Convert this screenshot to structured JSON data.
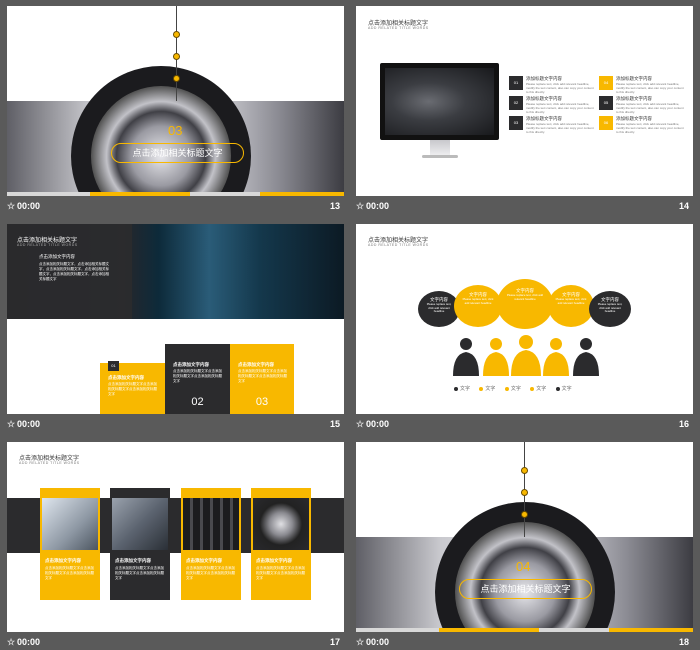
{
  "footer": {
    "time": "00:00",
    "star_icon": "star-icon"
  },
  "slides": [
    {
      "num": "13",
      "section_num": "03",
      "title": "点击添加相关标题文字"
    },
    {
      "num": "14",
      "title": "点击添加相关标题文字",
      "subtitle": "ADD RELATED TITLE WORDS",
      "items_left": [
        {
          "badge": "01",
          "heading": "添加标题文字内容"
        },
        {
          "badge": "02",
          "heading": "添加标题文字内容"
        },
        {
          "badge": "03",
          "heading": "添加标题文字内容"
        }
      ],
      "items_right": [
        {
          "badge": "04",
          "heading": "添加标题文字内容"
        },
        {
          "badge": "05",
          "heading": "添加标题文字内容"
        },
        {
          "badge": "06",
          "heading": "添加标题文字内容"
        }
      ],
      "body": "Please replace text, click add relevant headline, modify the text content, also can copy your content to this directly."
    },
    {
      "num": "15",
      "title": "点击添加相关标题文字",
      "subtitle": "ADD RELATED TITLE WORDS",
      "left_heading": "点击添加文字内容",
      "left_body": "点击添加相关标题文字，点击添加相关标题文字，点击添加相关标题文字，点击添加相关标题文字，点击添加相关标题文字，点击添加相关标题文字",
      "boxes": [
        {
          "label": "01",
          "heading": "点击添加文字内容"
        },
        {
          "label": "02",
          "heading": "点击添加文字内容"
        },
        {
          "label": "03",
          "heading": "点击添加文字内容"
        }
      ],
      "box_body": "点击添加相关标题文字点击添加相关标题文字点击添加相关标题文字"
    },
    {
      "num": "16",
      "title": "点击添加相关标题文字",
      "subtitle": "ADD RELATED TITLE WORDS",
      "bubbles": [
        {
          "heading": "文字内容"
        },
        {
          "heading": "文字内容"
        },
        {
          "heading": "文字内容"
        },
        {
          "heading": "文字内容"
        },
        {
          "heading": "文字内容"
        }
      ],
      "bubble_body": "Please replace text, click add relevant headline",
      "legend": [
        "文字",
        "文字",
        "文字",
        "文字",
        "文字"
      ]
    },
    {
      "num": "17",
      "title": "点击添加相关标题文字",
      "subtitle": "ADD RELATED TITLE WORDS",
      "cards": [
        {
          "heading": "点击添加文字内容"
        },
        {
          "heading": "点击添加文字内容"
        },
        {
          "heading": "点击添加文字内容"
        },
        {
          "heading": "点击添加文字内容"
        }
      ],
      "card_body": "点击添加相关标题文字点击添加相关标题文字点击添加相关标题文字"
    },
    {
      "num": "18",
      "section_num": "04",
      "title": "点击添加相关标题文字"
    }
  ],
  "colors": {
    "accent": "#f8b800",
    "dark": "#2b2b2d",
    "background": "#5a5a5a"
  }
}
